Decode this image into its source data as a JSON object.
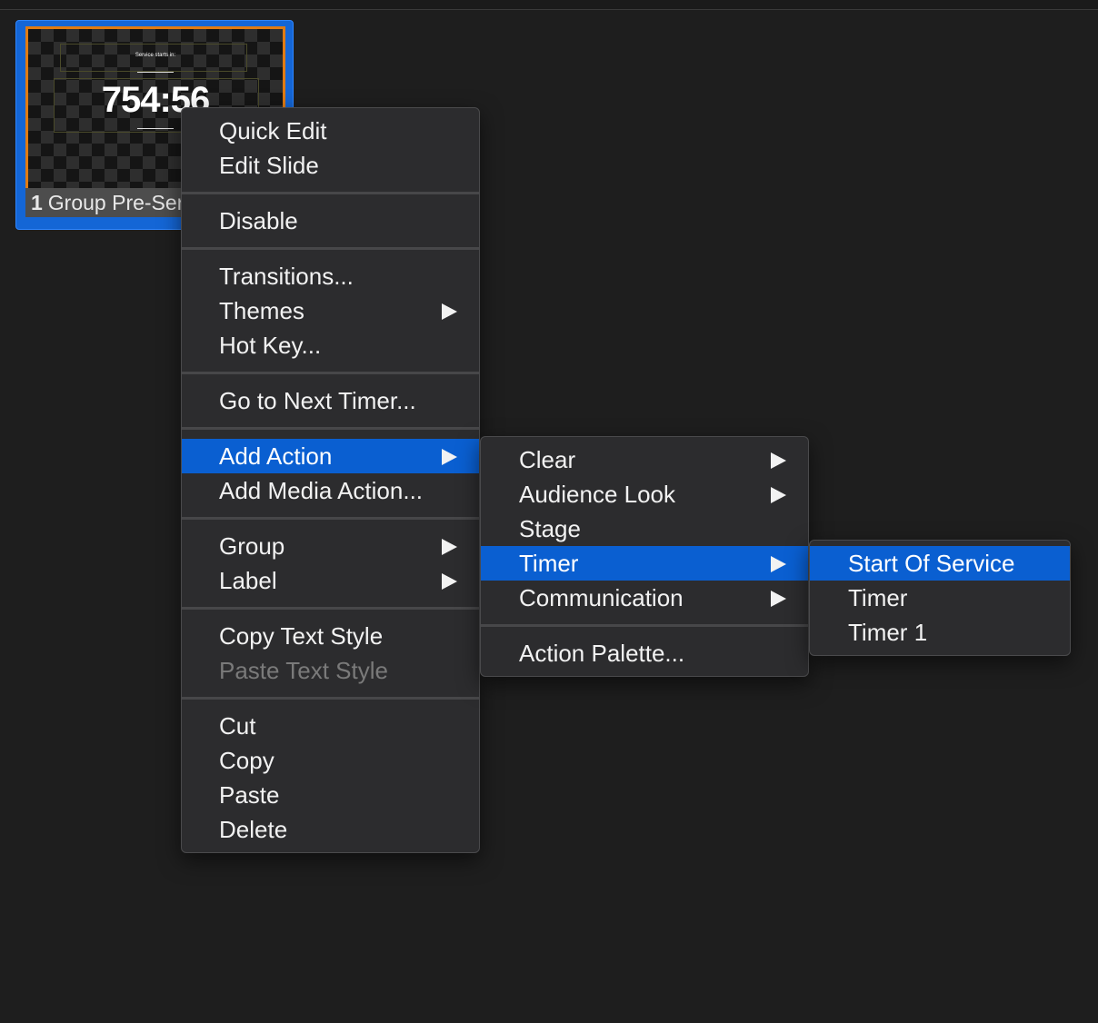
{
  "slide": {
    "small_text": "Service starts in:",
    "timer_text": "754:56",
    "number": "1",
    "group_label": "Group Pre-Service"
  },
  "context_menu": {
    "quick_edit": "Quick Edit",
    "edit_slide": "Edit Slide",
    "disable": "Disable",
    "transitions": "Transitions...",
    "themes": "Themes",
    "hot_key": "Hot Key...",
    "go_to_next_timer": "Go to Next Timer...",
    "add_action": "Add Action",
    "add_media_action": "Add Media Action...",
    "group": "Group",
    "label": "Label",
    "copy_text_style": "Copy Text Style",
    "paste_text_style": "Paste Text Style",
    "cut": "Cut",
    "copy": "Copy",
    "paste": "Paste",
    "delete": "Delete"
  },
  "add_action_submenu": {
    "clear": "Clear",
    "audience_look": "Audience Look",
    "stage": "Stage",
    "timer": "Timer",
    "communication": "Communication",
    "action_palette": "Action Palette..."
  },
  "timer_submenu": {
    "start_of_service": "Start Of Service",
    "timer": "Timer",
    "timer_1": "Timer 1"
  }
}
